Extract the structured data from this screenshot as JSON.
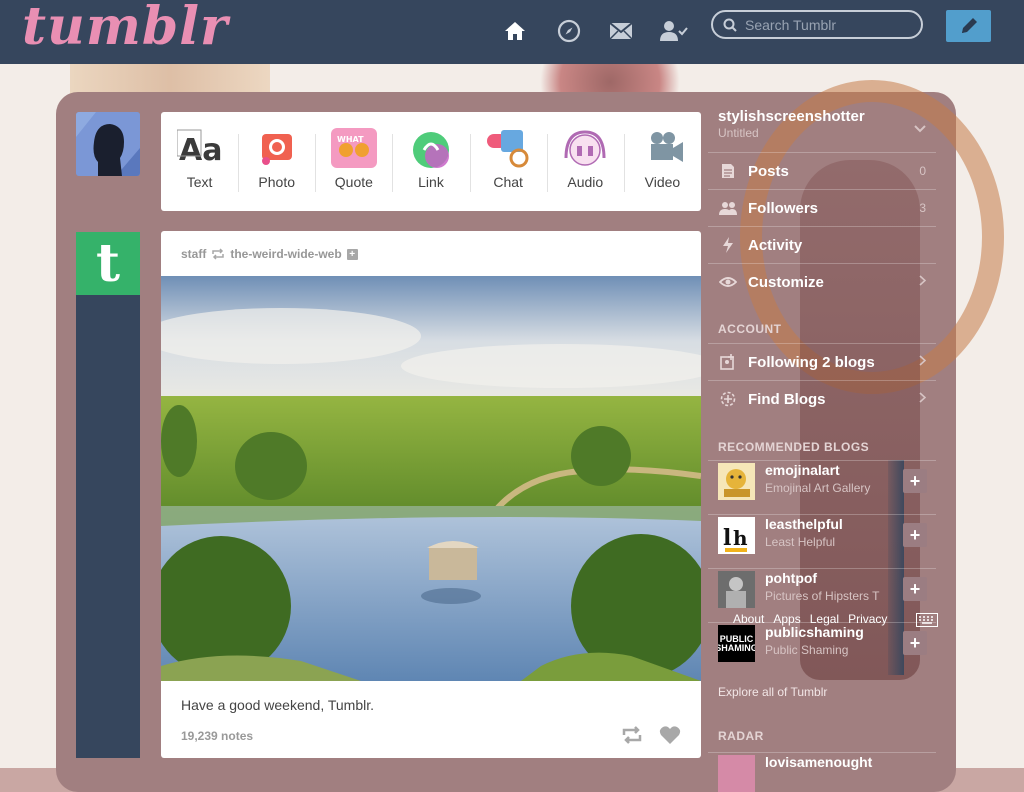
{
  "header": {
    "logo_text": "tumblr",
    "search_placeholder": "Search Tumblr",
    "icons": [
      "home-icon",
      "explore-icon",
      "inbox-icon",
      "account-icon",
      "compose-icon"
    ],
    "colors": {
      "bar": "#36465d",
      "logo": "#e98fb3",
      "compose": "#529ecc"
    }
  },
  "post_types": [
    {
      "label": "Text",
      "icon": "text-icon",
      "color": "#ffffff"
    },
    {
      "label": "Photo",
      "icon": "photo-icon",
      "color": "#f06150"
    },
    {
      "label": "Quote",
      "icon": "quote-icon",
      "color": "#f49ac1"
    },
    {
      "label": "Link",
      "icon": "link-icon",
      "color": "#4fcc7a"
    },
    {
      "label": "Chat",
      "icon": "chat-icon",
      "color": "#67a8e0"
    },
    {
      "label": "Audio",
      "icon": "audio-icon",
      "color": "#b06ab3"
    },
    {
      "label": "Video",
      "icon": "video-icon",
      "color": "#7fa3b8"
    }
  ],
  "post": {
    "author": "staff",
    "reblogged_from": "the-weird-wide-web",
    "caption": "Have a good weekend, Tumblr.",
    "notes": "19,239 notes"
  },
  "sidebar": {
    "blog_name": "stylishscreenshotter",
    "blog_subtitle": "Untitled",
    "rows": [
      {
        "label": "Posts",
        "count": "0",
        "icon": "posts-icon"
      },
      {
        "label": "Followers",
        "count": "3",
        "icon": "followers-icon"
      },
      {
        "label": "Activity",
        "count": "",
        "icon": "activity-icon"
      },
      {
        "label": "Customize",
        "count": "",
        "icon": "eye-icon"
      }
    ],
    "account_heading": "ACCOUNT",
    "account_rows": [
      {
        "label": "Following 2 blogs",
        "icon": "following-icon"
      },
      {
        "label": "Find Blogs",
        "icon": "find-blogs-icon"
      }
    ],
    "recommended_heading": "RECOMMENDED BLOGS",
    "recommended": [
      {
        "name": "emojinalart",
        "title": "Emojinal Art Gallery",
        "avatar": ""
      },
      {
        "name": "leasthelpful",
        "title": "Least Helpful",
        "avatar": "lh"
      },
      {
        "name": "pohtpof",
        "title": "Pictures of Hipsters T",
        "avatar": ""
      },
      {
        "name": "publicshaming",
        "title": "Public Shaming",
        "avatar": "PUBLIC SHAMING"
      }
    ],
    "footer_links": [
      "About",
      "Apps",
      "Legal",
      "Privacy"
    ],
    "explore_link": "Explore all of Tumblr",
    "radar_heading": "RADAR",
    "radar_item": "lovisamenought"
  }
}
